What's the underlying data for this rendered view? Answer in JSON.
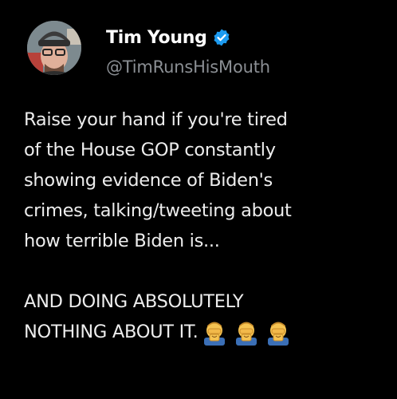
{
  "tweet": {
    "author": {
      "display_name": "Tim Young",
      "handle": "@TimRunsHisMouth",
      "verified_icon": "verified-badge-icon",
      "avatar_icon": "avatar"
    },
    "lines": [
      "Raise your hand if you're tired",
      "of the House GOP constantly",
      "showing evidence of Biden's",
      "crimes, talking/tweeting about",
      "how terrible Biden is..."
    ],
    "closing_lines": [
      "AND DOING ABSOLUTELY",
      "NOTHING ABOUT IT."
    ],
    "emojis": [
      "facepalm-emoji",
      "facepalm-emoji",
      "facepalm-emoji"
    ]
  },
  "colors": {
    "background": "#000000",
    "text": "#e7e9ea",
    "handle": "#8b8f94",
    "verified": "#1d9bf0"
  }
}
